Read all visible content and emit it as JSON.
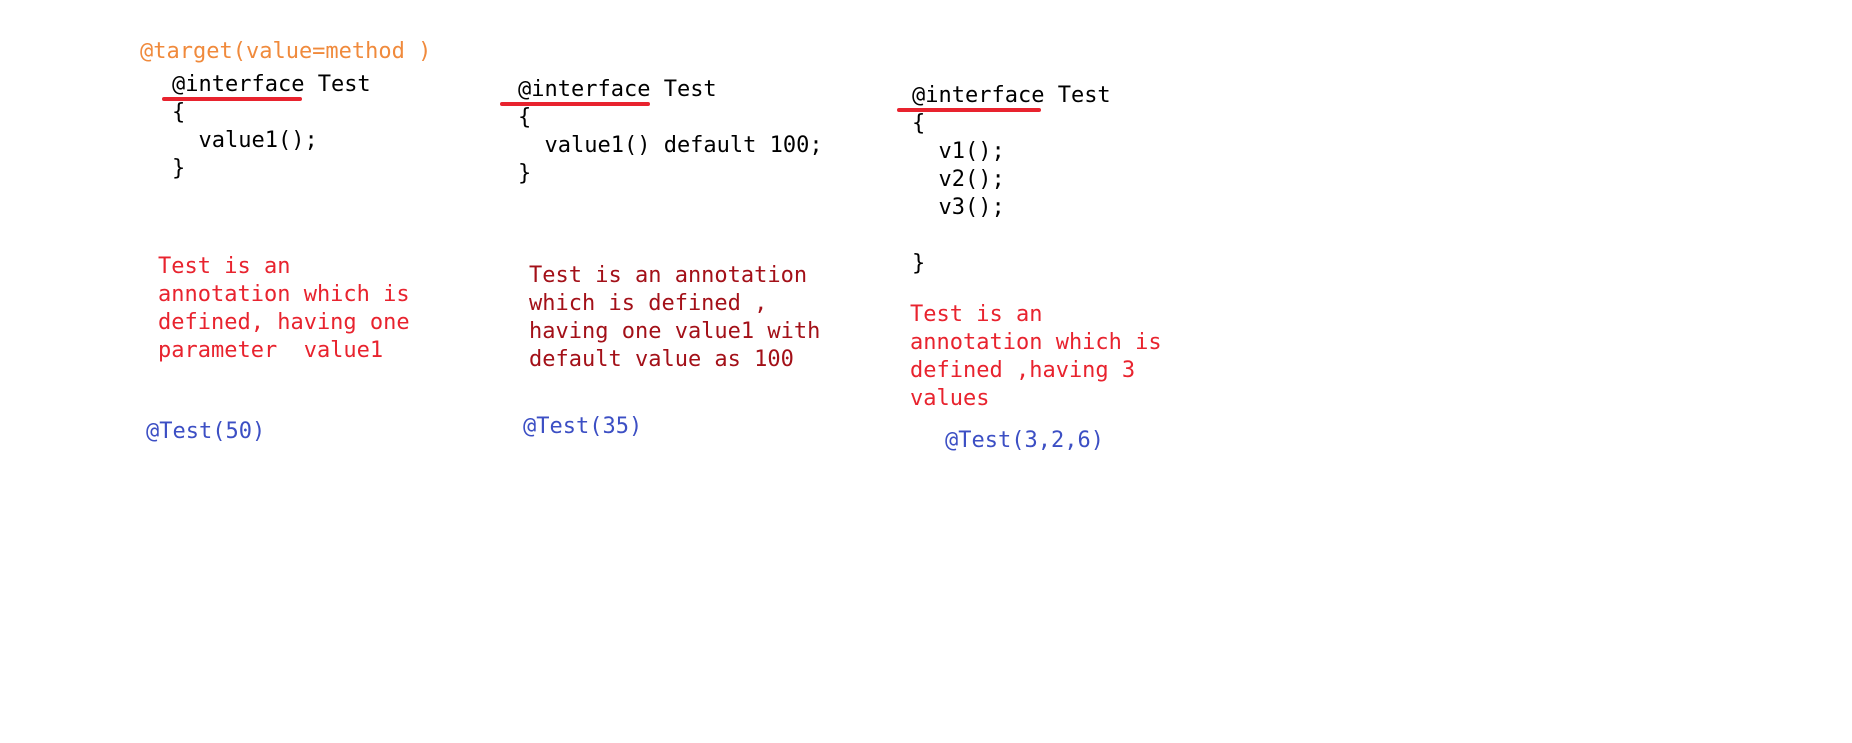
{
  "colors": {
    "code": "#000000",
    "target_annotation": "#f08a3c",
    "description_red": "#e8232e",
    "description_darkred": "#a31018",
    "usage_blue": "#3c4fc4",
    "underline": "#e8232e"
  },
  "blocks": [
    {
      "target": "@target(value=method )",
      "keyword": "@interface",
      "name": " Test",
      "open_brace": "{",
      "members": [
        "  value1();"
      ],
      "close_brace": "}",
      "description": [
        "Test is an",
        "annotation which is",
        "defined, having one",
        "parameter  value1"
      ],
      "usage": "@Test(50)"
    },
    {
      "keyword": "@interface",
      "name": " Test",
      "open_brace": "{",
      "members": [
        "  value1() default 100;"
      ],
      "close_brace": "}",
      "description": [
        "Test is an annotation",
        "which is defined ,",
        "having one value1 with",
        "default value as 100"
      ],
      "usage": "@Test(35)"
    },
    {
      "keyword": "@interface",
      "name": " Test",
      "open_brace": "{",
      "members": [
        "  v1();",
        "  v2();",
        "  v3();"
      ],
      "close_brace": "}",
      "description": [
        "Test is an",
        "annotation which is",
        "defined ,having 3",
        "values"
      ],
      "usage": "@Test(3,2,6)"
    }
  ]
}
